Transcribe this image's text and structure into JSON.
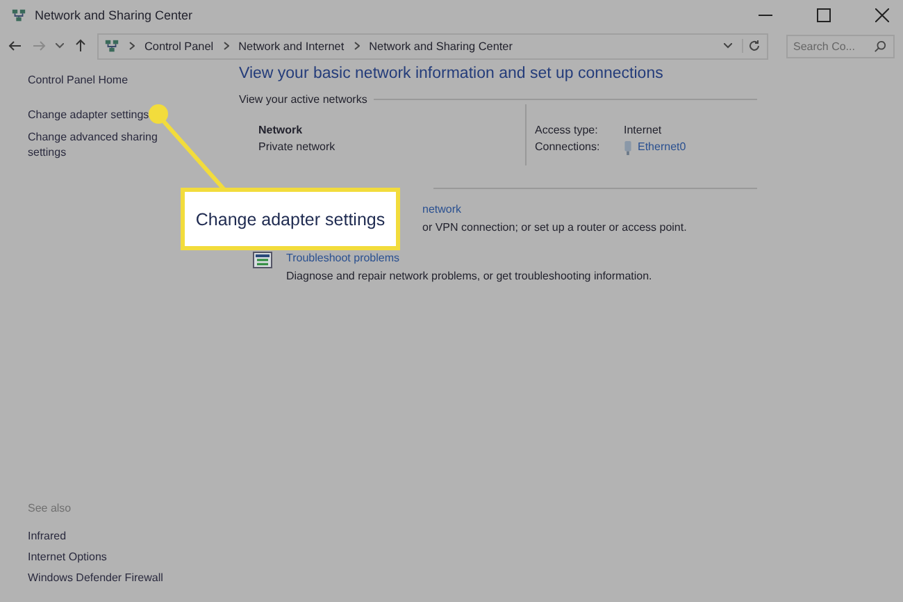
{
  "window": {
    "title": "Network and Sharing Center"
  },
  "address_bar": {
    "path": [
      "Control Panel",
      "Network and Internet",
      "Network and Sharing Center"
    ]
  },
  "search": {
    "placeholder": "Search Co..."
  },
  "sidebar": {
    "links": [
      "Control Panel Home",
      "Change adapter settings",
      "Change advanced sharing settings"
    ],
    "see_also": {
      "title": "See also",
      "links": [
        "Infrared",
        "Internet Options",
        "Windows Defender Firewall"
      ]
    }
  },
  "main": {
    "heading": "View your basic network information and set up connections",
    "active_networks": {
      "label": "View your active networks",
      "network": {
        "name": "Network",
        "type": "Private network"
      },
      "access_type": {
        "label": "Access type:",
        "value": "Internet"
      },
      "connections": {
        "label": "Connections:",
        "value": "Ethernet0"
      }
    },
    "tasks": [
      {
        "kind": "covered",
        "link": "network",
        "description": "or VPN connection; or set up a router or access point."
      },
      {
        "kind": "icon",
        "link": "Troubleshoot problems",
        "description": "Diagnose and repair network problems, or get troubleshooting information."
      }
    ]
  },
  "callout": {
    "text": "Change adapter settings"
  }
}
